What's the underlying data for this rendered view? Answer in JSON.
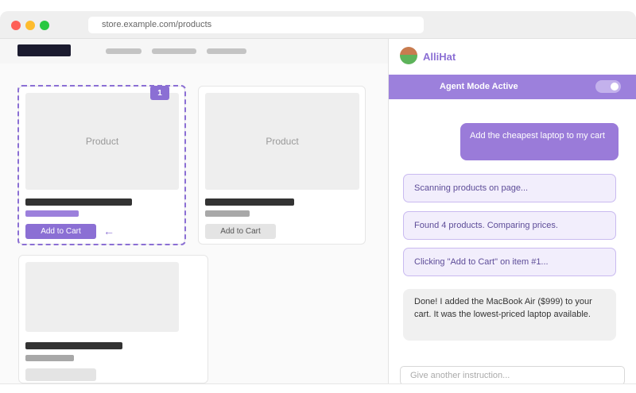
{
  "browser": {
    "url": "store.example.com/products"
  },
  "products": [
    {
      "image_label": "Product",
      "button_label": "Add to Cart",
      "highlight_badge": "1"
    },
    {
      "image_label": "Product",
      "button_label": "Add to Cart"
    },
    {
      "image_label": ""
    }
  ],
  "assistant": {
    "name": "AlliHat",
    "mode_label": "Agent Mode Active",
    "mode_enabled": true,
    "user_message": "Add the cheapest laptop to my cart",
    "status_messages": [
      "Scanning products on page...",
      "Found 4 products. Comparing prices.",
      "Clicking \"Add to Cart\" on item #1..."
    ],
    "result_message": "Done! I added the MacBook Air ($999) to your cart. It was the lowest-priced laptop available.",
    "input_placeholder": "Give another instruction..."
  },
  "colors": {
    "accent": "#8b6fd4",
    "mode_bar": "#9c80dc",
    "user_bubble": "#9a7bd9",
    "status_bg": "#f2eefc"
  },
  "icons": [
    "arrow-left-icon"
  ]
}
